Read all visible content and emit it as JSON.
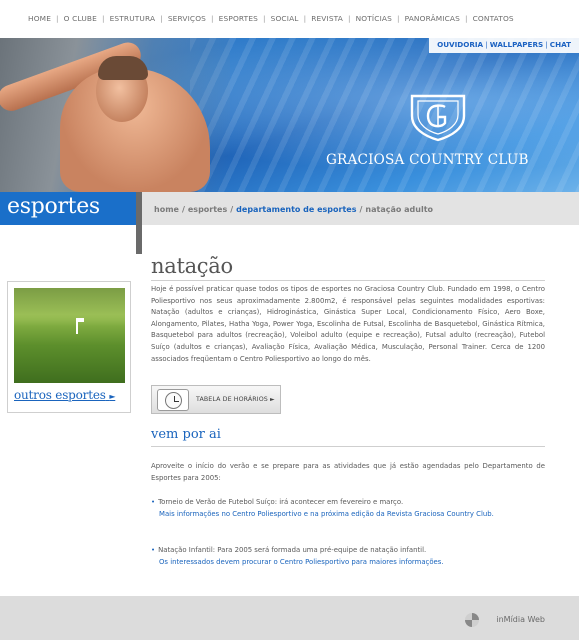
{
  "nav": {
    "items": [
      "HOME",
      "O CLUBE",
      "ESTRUTURA",
      "SERVIÇOS",
      "ESPORTES",
      "SOCIAL",
      "REVISTA",
      "NOTÍCIAS",
      "PANORÂMICAS",
      "CONTATOS"
    ]
  },
  "header": {
    "links": [
      "OUVIDORIA",
      "WALLPAPERS",
      "CHAT"
    ],
    "club_name": "GRACIOSA COUNTRY CLUB"
  },
  "section": {
    "title": "esportes"
  },
  "breadcrumb": {
    "items": [
      "home",
      "esportes",
      "departamento de esportes",
      "natação adulto"
    ]
  },
  "sidebar": {
    "more_label": "outros esportes"
  },
  "main": {
    "title": "natação",
    "intro": "Hoje é possível praticar quase todos os tipos de esportes no Graciosa Country Club. Fundado em 1998, o Centro Poliesportivo nos seus aproximadamente 2.800m2, é responsável pelas seguintes modalidades esportivas: Natação (adultos e crianças), Hidroginástica, Ginástica Super Local, Condicionamento Físico, Aero Boxe, Alongamento, Pilates, Hatha Yoga, Power Yoga, Escolinha de Futsal, Escolinha de Basquetebol, Ginástica Rítmica, Basquetebol para adultos (recreação), Voleibol adulto (equipe e recreação), Futsal adulto (recreação), Futebol Suíço (adultos e crianças), Avaliação Física, Avaliação Médica, Musculação, Personal Trainer. Cerca de 1200 associados freqüentam o Centro Poliesportivo ao longo do mês.",
    "schedule_button": "TABELA DE HORÁRIOS",
    "subtitle": "vem por ai",
    "paragraph": "Aproveite o início do verão e se prepare para as atividades que já estão agendadas pelo Departamento de Esportes para 2005:",
    "news": [
      {
        "text": "Torneio de Verão de Futebol Suíço: irá acontecer em fevereiro e março.",
        "link": "Mais informações no Centro Poliesportivo e na próxima edição da Revista Graciosa Country Club."
      },
      {
        "text": "Natação Infantil: Para 2005 será formada uma pré-equipe de natação infantil.",
        "link": "Os interessados devem procurar o Centro Poliesportivo para maiores informações."
      }
    ]
  },
  "footer": {
    "credit": "inMídia Web"
  },
  "colors": {
    "accent_blue": "#1a6fc9",
    "link_blue": "#1a64bd"
  }
}
